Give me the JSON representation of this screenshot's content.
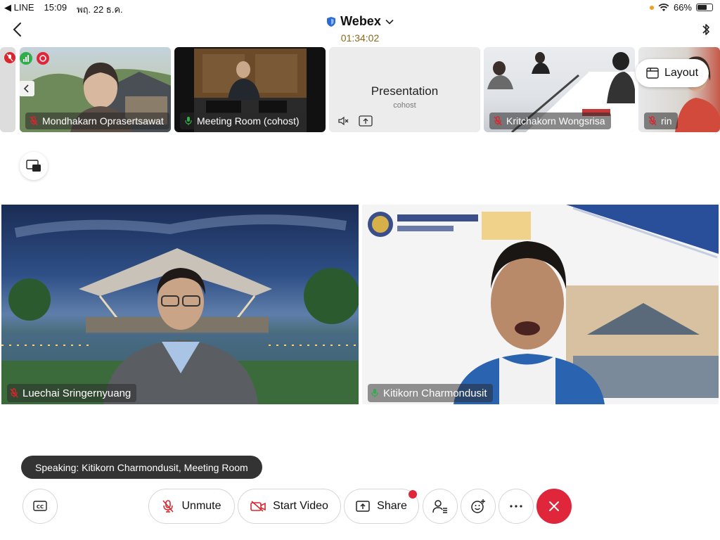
{
  "status_bar": {
    "back_app": "◀ LINE",
    "time": "15:09",
    "date": "พฤ. 22 ธ.ค.",
    "battery": "66%"
  },
  "header": {
    "title": "Webex",
    "timer": "01:34:02"
  },
  "participants": [
    {
      "name": "Mondhakarn Oprasertsawat",
      "muted": true
    },
    {
      "name": "Meeting Room (cohost)",
      "muted": false
    },
    {
      "name": "Kritchakorn Wongsrisa",
      "muted": true
    },
    {
      "name": "rin",
      "muted": true
    }
  ],
  "presentation": {
    "title": "Presentation",
    "subtitle": "cohost"
  },
  "layout_button": "Layout",
  "main_videos": [
    {
      "name": "Luechai Sringernyuang",
      "muted": true
    },
    {
      "name": "Kitikorn Charmondusit",
      "muted": false
    }
  ],
  "speaking": "Speaking: Kitikorn Charmondusit, Meeting Room",
  "controls": {
    "unmute": "Unmute",
    "start_video": "Start Video",
    "share": "Share",
    "cc": "CC"
  },
  "colors": {
    "accent_red": "#e0263a",
    "mic_muted": "#d9262f",
    "mic_on": "#2fae4a",
    "timer": "#8a6a1a"
  }
}
